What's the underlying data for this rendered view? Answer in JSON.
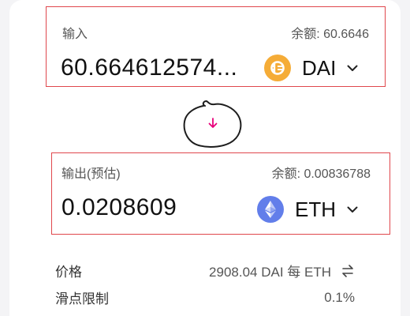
{
  "input": {
    "label": "输入",
    "balance": "余额: 60.6646",
    "amount": "60.664612574...",
    "token": {
      "symbol": "DAI",
      "icon": "dai-icon",
      "color": "#f5ac37"
    }
  },
  "output": {
    "label": "输出(预估)",
    "balance": "余额: 0.00836788",
    "amount": "0.0208609",
    "token": {
      "symbol": "ETH",
      "icon": "eth-icon",
      "color": "#627eea"
    }
  },
  "switch": {
    "icon": "arrow-down-icon",
    "color": "#e8007a"
  },
  "details": {
    "price_label": "价格",
    "price_value": "2908.04 DAI 每 ETH",
    "price_invert_icon": "swap-arrows-icon",
    "slippage_label": "滑点限制",
    "slippage_value": "0.1%"
  },
  "colors": {
    "highlight_border": "#e0474c"
  }
}
